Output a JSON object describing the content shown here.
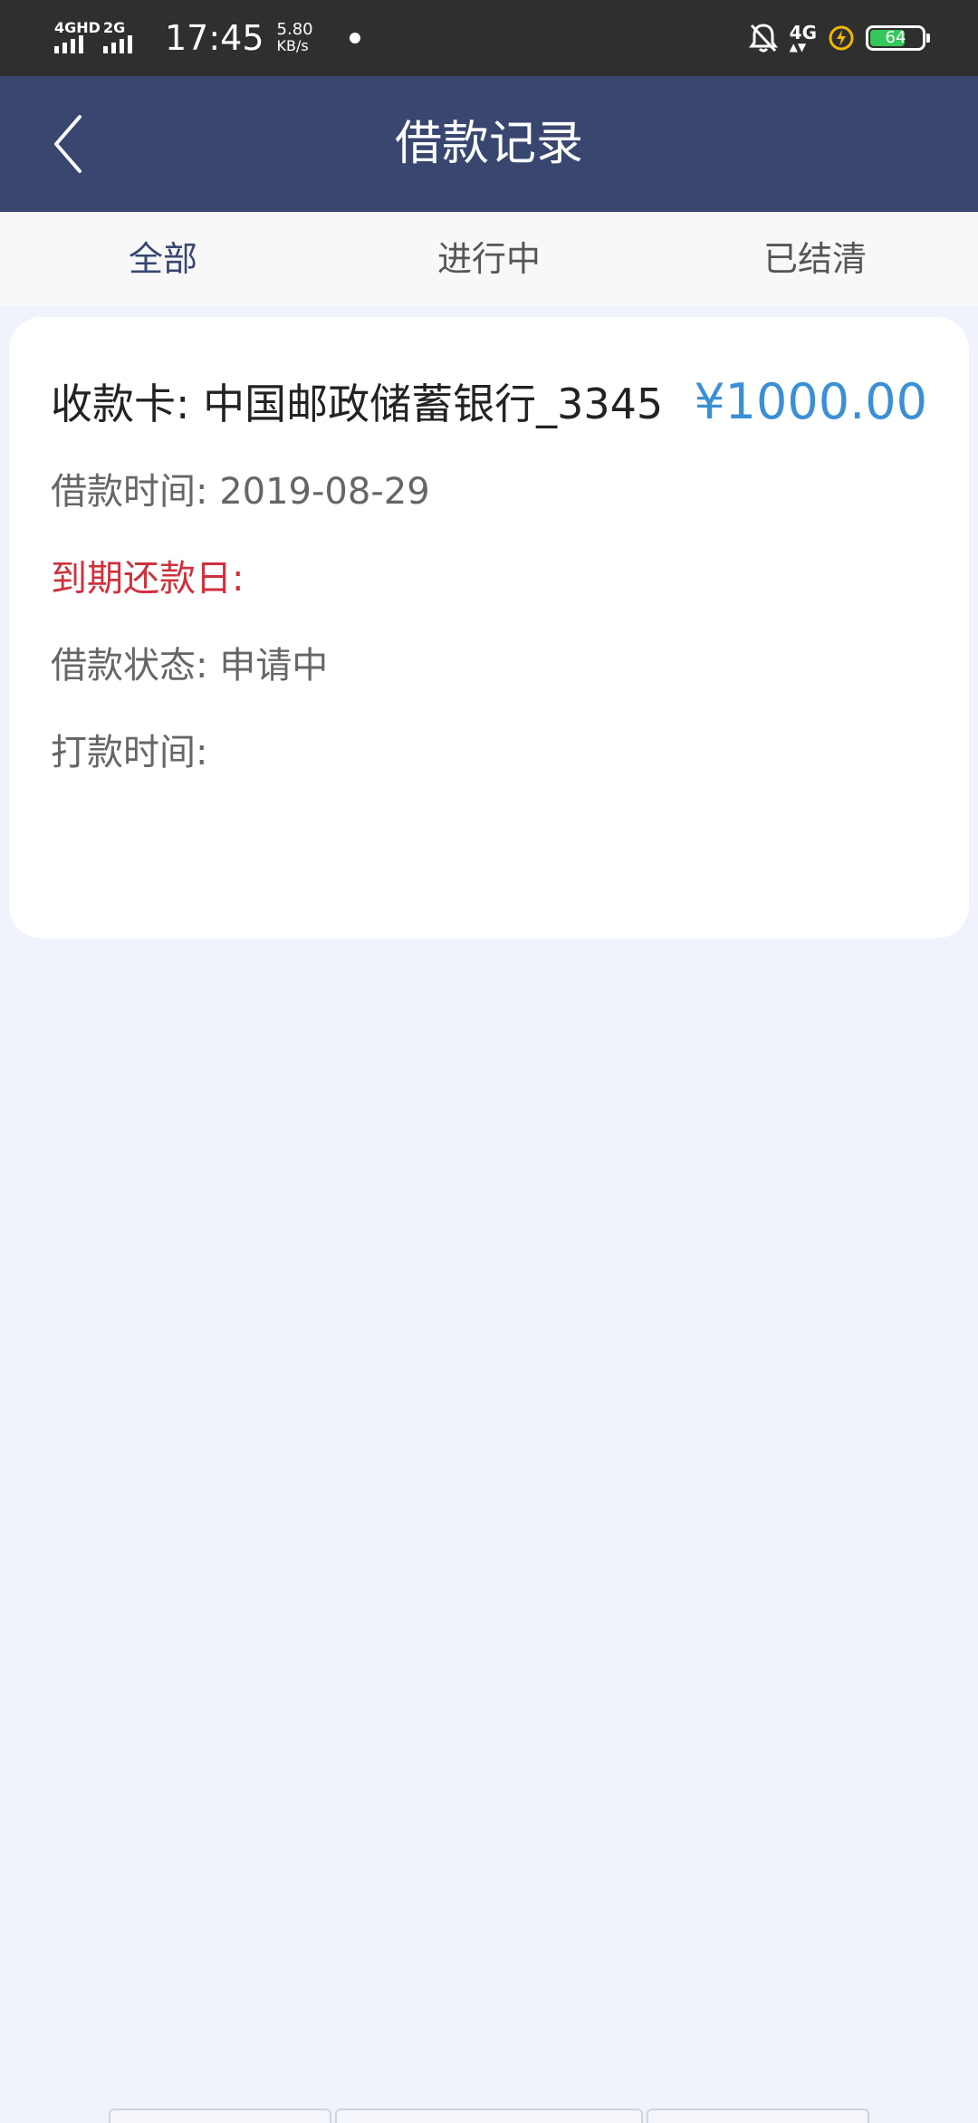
{
  "status_bar": {
    "network1": "4GHD",
    "network2": "2G",
    "time": "17:45",
    "speed_value": "5.80",
    "speed_unit": "KB/s",
    "network_right": "4G",
    "battery_level": "64",
    "icons": [
      "signal-icon",
      "mute-bell-icon",
      "charging-icon",
      "battery-icon"
    ]
  },
  "header": {
    "title": "借款记录",
    "back_icon": "back-chevron-icon"
  },
  "tabs": [
    {
      "label": "全部",
      "active": true
    },
    {
      "label": "进行中",
      "active": false
    },
    {
      "label": "已结清",
      "active": false
    }
  ],
  "records": [
    {
      "bank_label": "收款卡: ",
      "bank_value": "中国邮政储蓄银行_3345",
      "amount": "¥1000.00",
      "loan_time_label": "借款时间: ",
      "loan_time_value": "2019-08-29",
      "due_label": "到期还款日:",
      "status_label": "借款状态: ",
      "status_value": "申请中",
      "payout_label": "打款时间:"
    }
  ],
  "colors": {
    "header_bg": "#384670",
    "page_bg": "#f0f3fb",
    "amount": "#3b8fd6",
    "due": "#d0303c"
  }
}
